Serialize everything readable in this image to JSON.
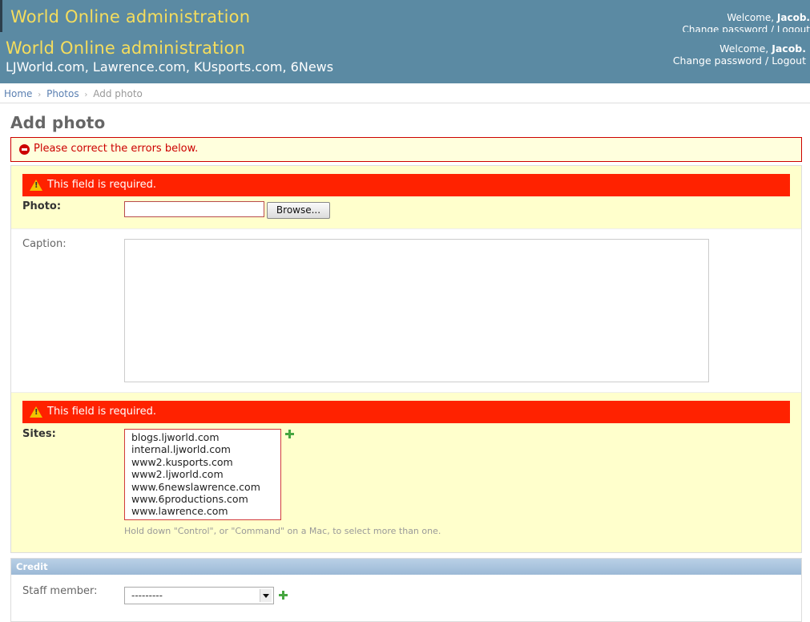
{
  "ghost_header": {
    "title": "World Online administration",
    "welcome": "Welcome,",
    "user": "Jacob.",
    "links": "Change password / Logout"
  },
  "header": {
    "title": "World Online administration",
    "subtitle": "LJWorld.com, Lawrence.com, KUsports.com, 6News",
    "welcome": "Welcome,",
    "user": "Jacob.",
    "change_password": "Change password",
    "separator": "/",
    "logout": "Logout"
  },
  "breadcrumbs": {
    "home": "Home",
    "photos": "Photos",
    "current": "Add photo",
    "sep": "›"
  },
  "page_title": "Add photo",
  "errornote": "Please correct the errors below.",
  "form": {
    "photo": {
      "error": "This field is required.",
      "label": "Photo:",
      "value": "",
      "browse_label": "Browse..."
    },
    "caption": {
      "label": "Caption:",
      "value": ""
    },
    "sites": {
      "error": "This field is required.",
      "label": "Sites:",
      "options": [
        "blogs.ljworld.com",
        "internal.ljworld.com",
        "www2.kusports.com",
        "www2.ljworld.com",
        "www.6newslawrence.com",
        "www.6productions.com",
        "www.lawrence.com"
      ],
      "help": "Hold down \"Control\", or \"Command\" on a Mac, to select more than one."
    }
  },
  "credit": {
    "heading": "Credit",
    "staff_label": "Staff member:",
    "staff_selected": "---------"
  },
  "colors": {
    "header_bg": "#5b8aa3",
    "title_yellow": "#f5dd5d",
    "error_red": "#ff2200",
    "error_row_bg": "#ffffcc",
    "link_blue": "#5b80b2"
  }
}
